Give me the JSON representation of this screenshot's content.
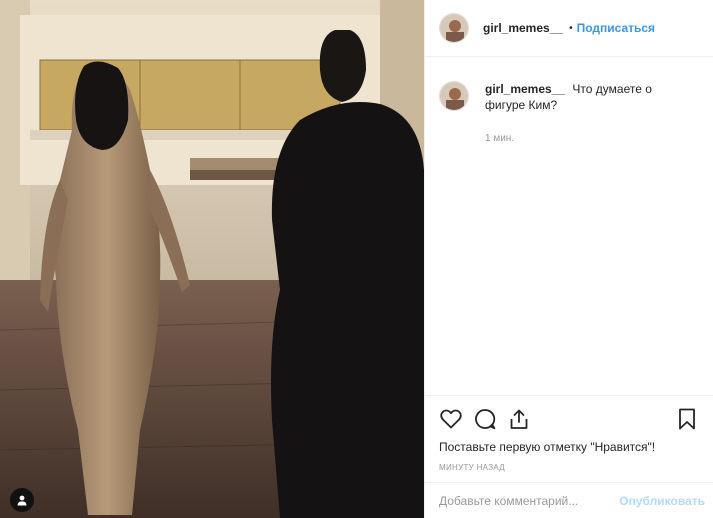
{
  "post": {
    "username": "girl_memes__",
    "separator": "•",
    "follow_label": "Подписаться"
  },
  "comment": {
    "username": "girl_memes__",
    "text": "Что думаете о фигуре Ким?",
    "time": "1 мин."
  },
  "actions": {
    "likes_text": "Поставьте первую отметку \"Нравится\"!",
    "post_time": "МИНУТУ НАЗАД",
    "icons": [
      "heart-icon",
      "comment-icon",
      "share-icon",
      "bookmark-icon"
    ]
  },
  "add_comment": {
    "placeholder": "Добавьте комментарий...",
    "publish_label": "Опубликовать"
  },
  "colors": {
    "link": "#3897f0",
    "publish_disabled": "#b3dbff",
    "muted": "#999999",
    "text": "#262626"
  }
}
